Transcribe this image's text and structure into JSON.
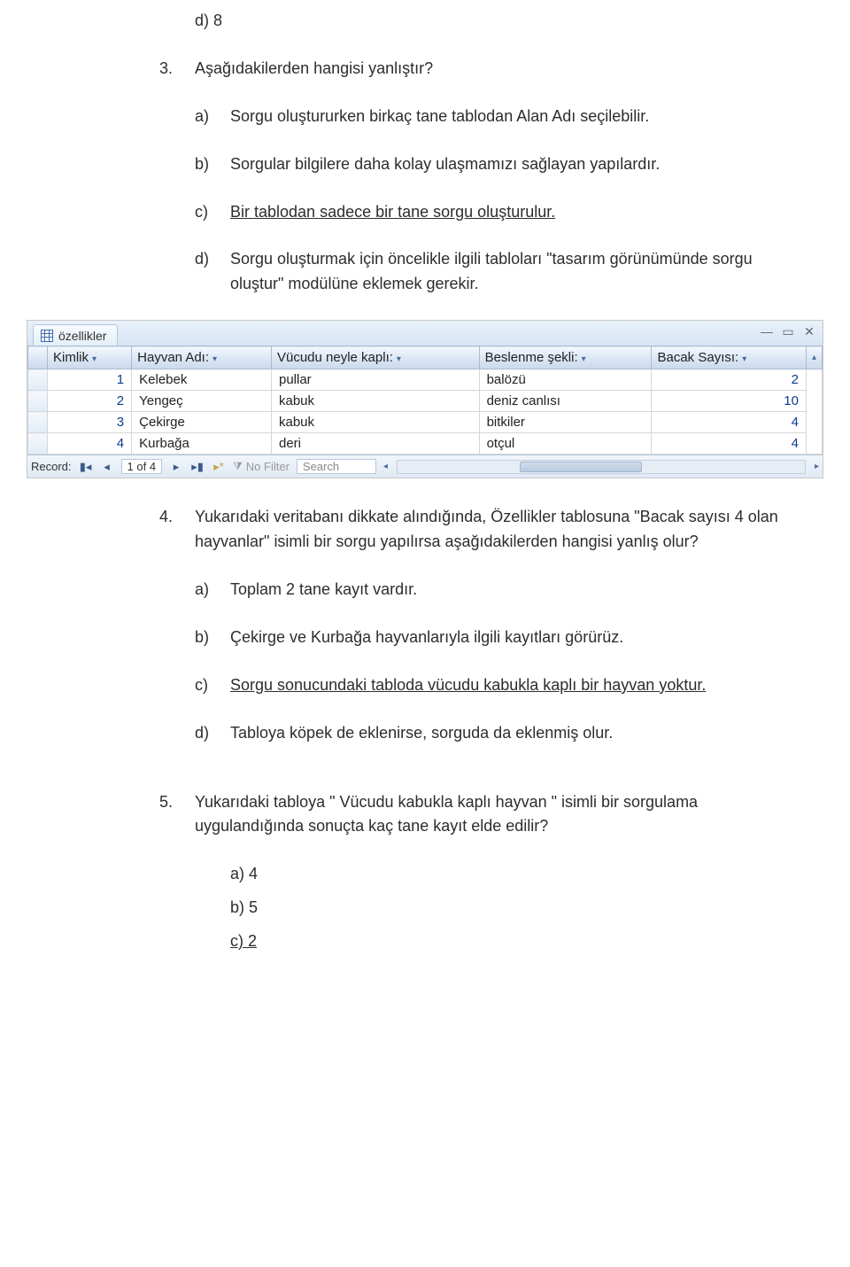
{
  "q2": {
    "d": "d) 8"
  },
  "q3": {
    "num": "3.",
    "stem": "Aşağıdakilerden hangisi yanlıştır?",
    "a_num": "a)",
    "a": "Sorgu oluştururken birkaç tane tablodan Alan Adı seçilebilir.",
    "b_num": "b)",
    "b": "Sorgular bilgilere daha kolay ulaşmamızı sağlayan yapılardır.",
    "c_num": "c)",
    "c": "Bir tablodan sadece bir tane sorgu oluşturulur.",
    "d_num": "d)",
    "d": "Sorgu oluşturmak için öncelikle ilgili tabloları \"tasarım görünümünde sorgu oluştur\"  modülüne eklemek gerekir."
  },
  "window": {
    "tab_label": "özellikler",
    "record_label": "Record:",
    "record_value": "1 of 4",
    "no_filter": "No Filter",
    "search": "Search"
  },
  "table": {
    "headers": {
      "kimlik": "Kimlik",
      "hayvan": "Hayvan Adı:",
      "vucut": "Vücudu neyle kaplı:",
      "beslenme": "Beslenme şekli:",
      "bacak": "Bacak Sayısı:"
    },
    "rows": [
      {
        "kimlik": "1",
        "hayvan": "Kelebek",
        "vucut": "pullar",
        "beslenme": "balözü",
        "bacak": "2"
      },
      {
        "kimlik": "2",
        "hayvan": "Yengeç",
        "vucut": "kabuk",
        "beslenme": "deniz canlısı",
        "bacak": "10"
      },
      {
        "kimlik": "3",
        "hayvan": "Çekirge",
        "vucut": "kabuk",
        "beslenme": "bitkiler",
        "bacak": "4"
      },
      {
        "kimlik": "4",
        "hayvan": "Kurbağa",
        "vucut": "deri",
        "beslenme": "otçul",
        "bacak": "4"
      }
    ]
  },
  "q4": {
    "num": "4.",
    "stem": "Yukarıdaki veritabanı dikkate alındığında, Özellikler tablosuna \"Bacak sayısı 4 olan hayvanlar\" isimli bir sorgu yapılırsa aşağıdakilerden hangisi yanlış olur?",
    "a_num": "a)",
    "a": "Toplam 2 tane kayıt vardır.",
    "b_num": "b)",
    "b": "Çekirge ve Kurbağa hayvanlarıyla ilgili kayıtları görürüz.",
    "c_num": "c)",
    "c": "Sorgu sonucundaki tabloda vücudu kabukla kaplı bir hayvan yoktur.",
    "d_num": "d)",
    "d": "Tabloya köpek de eklenirse, sorguda da eklenmiş olur."
  },
  "q5": {
    "num": "5.",
    "stem": "Yukarıdaki tabloya \" Vücudu kabukla kaplı hayvan \" isimli bir sorgulama uygulandığında sonuçta kaç tane kayıt elde edilir?",
    "a": "a) 4",
    "b": "b) 5",
    "c": "c) 2"
  }
}
